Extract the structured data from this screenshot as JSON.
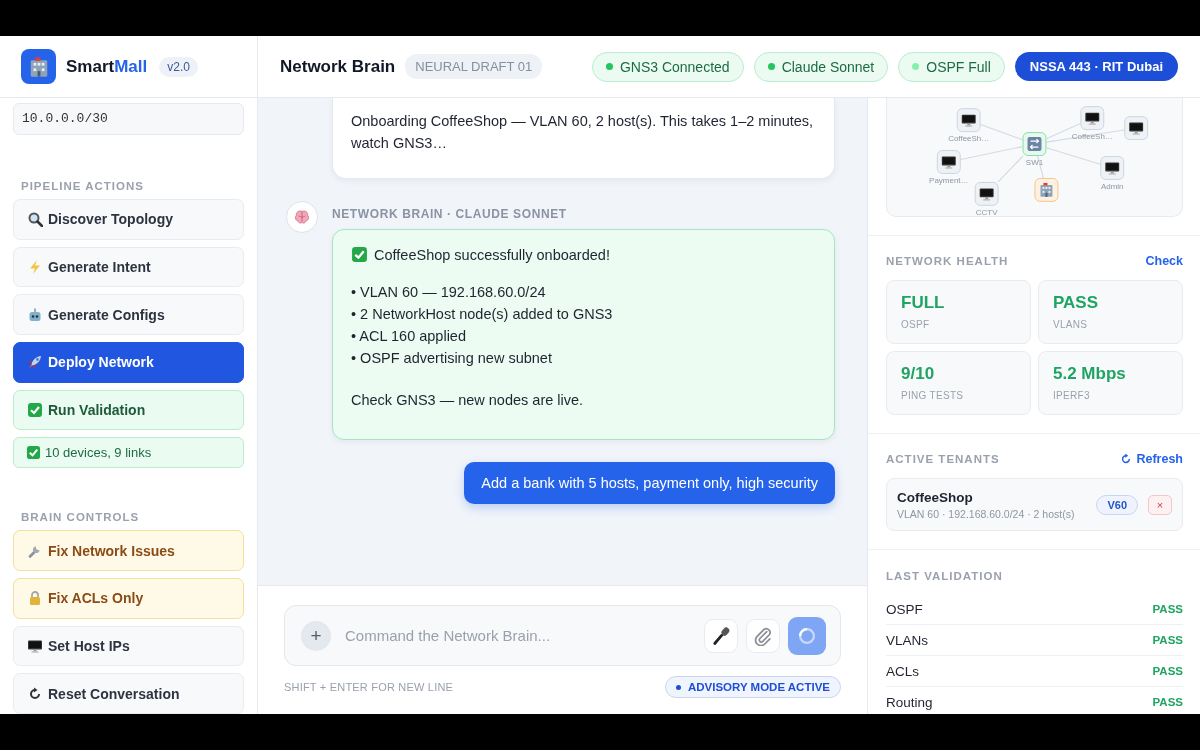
{
  "brand": {
    "name_parts": [
      "Smart",
      "Mall"
    ],
    "version": "v2.0"
  },
  "header": {
    "title": "Network Brain",
    "draft_badge": "NEURAL DRAFT 01",
    "status_pills": [
      {
        "label": "GNS3 Connected",
        "color": "#22c55e"
      },
      {
        "label": "Claude Sonnet",
        "color": "#22c55e"
      },
      {
        "label": "OSPF Full",
        "color": "#86efac"
      }
    ],
    "course_badge": "NSSA 443 · RIT Dubai"
  },
  "sidebar": {
    "subnet_value": "10.0.0.0/30",
    "sections": [
      {
        "title": "PIPELINE ACTIONS",
        "buttons": [
          {
            "label": "Discover Topology",
            "kind": "default"
          },
          {
            "label": "Generate Intent",
            "kind": "default"
          },
          {
            "label": "Generate Configs",
            "kind": "default"
          },
          {
            "label": "Deploy Network",
            "kind": "primary"
          },
          {
            "label": "Run Validation",
            "kind": "success"
          }
        ],
        "status": "10 devices, 9 links"
      },
      {
        "title": "BRAIN CONTROLS",
        "buttons": [
          {
            "label": "Fix Network Issues",
            "kind": "warning"
          },
          {
            "label": "Fix ACLs Only",
            "kind": "warning"
          },
          {
            "label": "Set Host IPs",
            "kind": "default"
          },
          {
            "label": "Reset Conversation",
            "kind": "default"
          }
        ]
      }
    ]
  },
  "chat": {
    "messages": [
      {
        "kind": "bot",
        "paragraphs": [
          "Onboarding CoffeeShop — VLAN 60, 2 host(s). This takes 1–2 minutes, watch GNS3…"
        ]
      },
      {
        "kind": "bot_success",
        "sender": "NETWORK BRAIN · CLAUDE SONNET",
        "heading": "CoffeeShop successfully onboarded!",
        "paragraphs": [
          "• VLAN 60 — 192.168.60.0/24\n• 2 NetworkHost node(s) added to GNS3\n• ACL 160 applied\n• OSPF advertising new subnet",
          "Check GNS3 — new nodes are live."
        ]
      },
      {
        "kind": "user",
        "paragraphs": [
          "Add a bank with 5 hosts, payment only, high security"
        ]
      }
    ],
    "composer": {
      "attach_label": "+",
      "placeholder": "Command the Network Brain...",
      "hint": "SHIFT + ENTER FOR NEW LINE",
      "mode_badge": "ADVISORY MODE ACTIVE"
    }
  },
  "topology": {
    "nodes": [
      {
        "kind": "switch",
        "label": "SW1"
      },
      {
        "kind": "host",
        "label": "CoffeeSh…"
      },
      {
        "kind": "host",
        "label": "Payment…"
      },
      {
        "kind": "host",
        "label": "CCTV"
      },
      {
        "kind": "host",
        "label": "Admin"
      },
      {
        "kind": "host",
        "label": "CoffeeSh…"
      },
      {
        "kind": "host"
      },
      {
        "kind": "building"
      }
    ]
  },
  "health": {
    "title": "NETWORK HEALTH",
    "action": "Check",
    "cards": [
      {
        "value": "FULL",
        "label": "OSPF"
      },
      {
        "value": "PASS",
        "label": "VLANS"
      },
      {
        "value": "9/10",
        "label": "PING TESTS"
      },
      {
        "value": "5.2 Mbps",
        "label": "IPERF3"
      }
    ]
  },
  "tenants": {
    "title": "ACTIVE TENANTS",
    "action": "Refresh",
    "items": [
      {
        "name": "CoffeeShop",
        "detail": "VLAN 60 · 192.168.60.0/24 · 2 host(s)",
        "vlan": "V60",
        "remove_label": "×"
      }
    ]
  },
  "validation": {
    "title": "LAST VALIDATION",
    "rows": [
      {
        "check": "OSPF",
        "result": "PASS"
      },
      {
        "check": "VLANs",
        "result": "PASS"
      },
      {
        "check": "ACLs",
        "result": "PASS"
      },
      {
        "check": "Routing",
        "result": "PASS"
      }
    ]
  }
}
